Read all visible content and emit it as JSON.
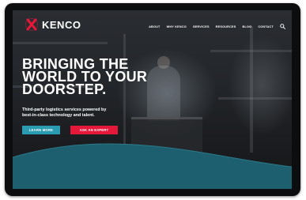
{
  "brand": {
    "name": "KENCO"
  },
  "nav": {
    "links": [
      "ABOUT",
      "WHY KENCO",
      "SERVICES",
      "RESOURCES",
      "BLOG",
      "CONTACT"
    ],
    "search_icon": "search-icon"
  },
  "hero": {
    "headline": [
      "BRINGING THE",
      "WORLD TO YOUR",
      "DOORSTEP."
    ],
    "subtext_lines": [
      "Third-party logistics services powered by",
      "best-in-class technology and talent."
    ],
    "learn_more_label": "LEARN MORE",
    "ask_expert_label": "ASK AN EXPERT"
  },
  "colors": {
    "accent_teal": "#2a9bb0",
    "accent_red": "#e5183a",
    "wave_teal": "#1d5f6e"
  }
}
